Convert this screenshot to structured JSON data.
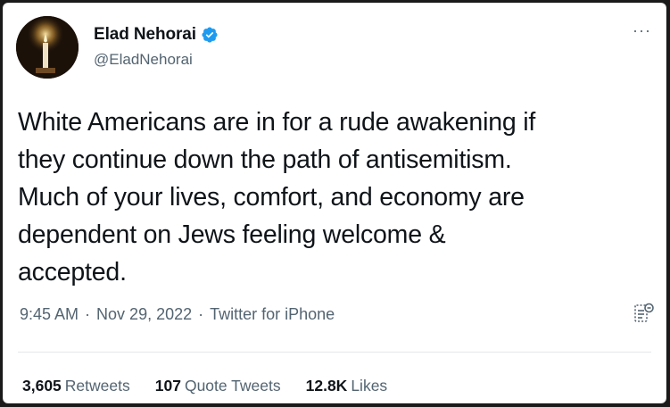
{
  "tweet": {
    "author": {
      "name": "Elad Nehorai",
      "handle": "@EladNehorai",
      "avatar_icon": "candle-avatar",
      "verified_icon": "verified-badge-icon",
      "verified_color": "#1d9bf0"
    },
    "more_icon_label": "···",
    "text": "White Americans are in for a rude awakening if\nthey continue down the path of antisemitism.\nMuch of your lives, comfort, and economy are\ndependent on Jews feeling welcome &\naccepted.",
    "time": "9:45 AM",
    "date": "Nov 29, 2022",
    "separator": "·",
    "source": "Twitter for iPhone",
    "analytics_icon": "analytics-icon",
    "stats": {
      "retweets": {
        "count": "3,605",
        "label": "Retweets"
      },
      "quote_tweets": {
        "count": "107",
        "label": "Quote Tweets"
      },
      "likes": {
        "count": "12.8K",
        "label": "Likes"
      }
    }
  },
  "colors": {
    "text_primary": "#0f1419",
    "text_secondary": "#536471",
    "accent": "#1d9bf0",
    "background": "#ffffff"
  }
}
